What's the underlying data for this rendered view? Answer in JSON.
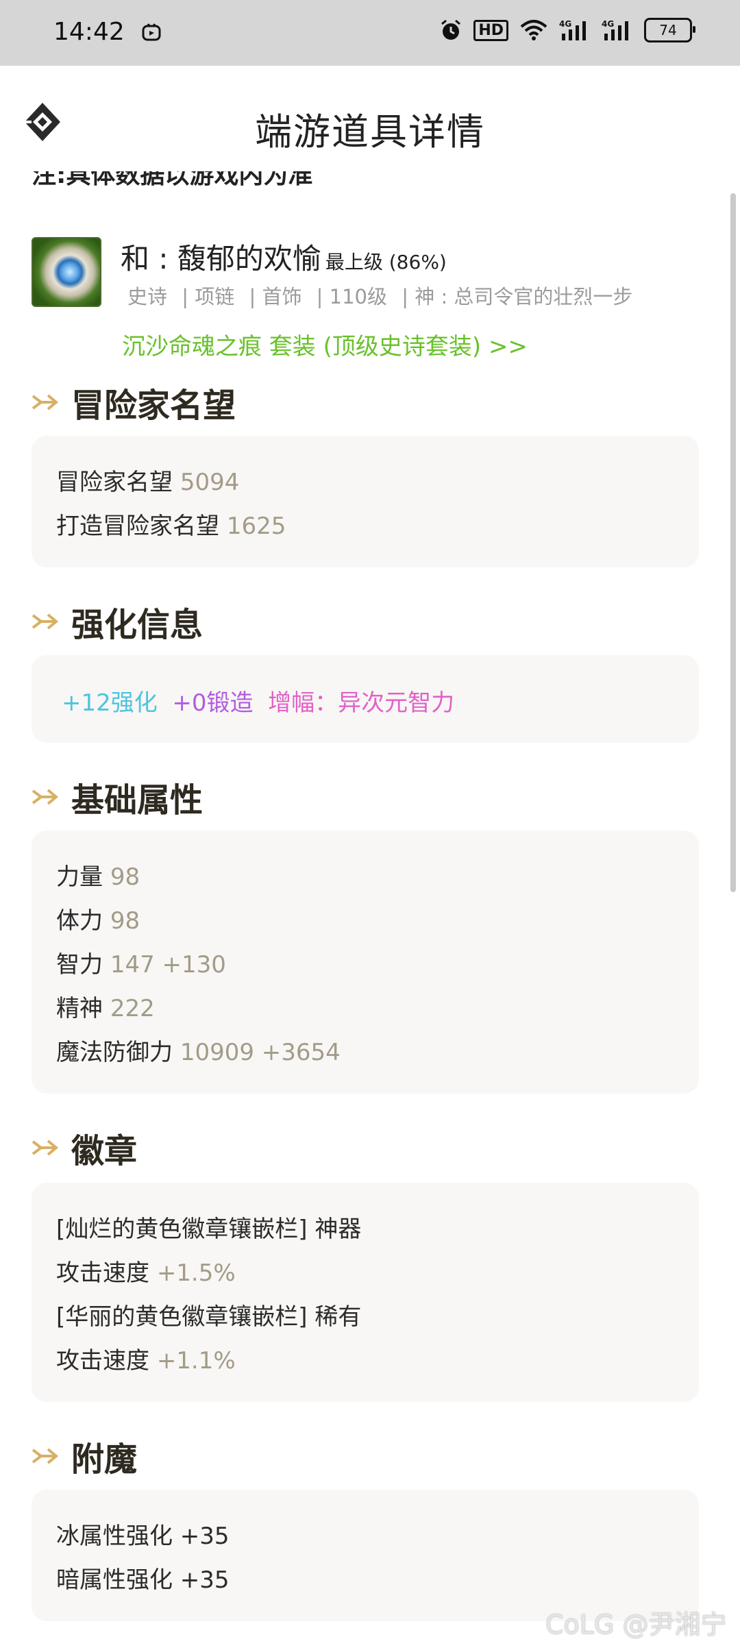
{
  "status_bar": {
    "time": "14:42",
    "battery": "74",
    "icons": [
      "tiktok-icon",
      "alarm-icon",
      "hd-icon",
      "wifi-icon",
      "signal-4g-icon",
      "signal-4g-icon",
      "battery-icon"
    ]
  },
  "header": {
    "title": "端游道具详情"
  },
  "note": "注:具体数据以游戏内为准",
  "item": {
    "name": "和 : 馥郁的欢愉",
    "level_tag": "最上级 (86%)",
    "meta": [
      "史诗",
      "| 项链",
      "| 首饰",
      "| 110级",
      "| 神 : 总司令官的壮烈一步"
    ],
    "set_link": "沉沙命魂之痕 套装 (顶级史诗套装)  >>"
  },
  "sections": {
    "reputation": {
      "title": "冒险家名望",
      "rows": [
        {
          "label": "冒险家名望",
          "value": "5094"
        },
        {
          "label": "打造冒险家名望",
          "value": "1625"
        }
      ]
    },
    "enhance": {
      "title": "强化信息",
      "reinforce": "+12强化",
      "forge": "+0锻造",
      "amplify": "增幅：异次元智力"
    },
    "base_attr": {
      "title": "基础属性",
      "rows": [
        {
          "label": "力量",
          "value": "98"
        },
        {
          "label": "体力",
          "value": "98"
        },
        {
          "label": "智力",
          "value": "147 +130"
        },
        {
          "label": "精神",
          "value": "222"
        },
        {
          "label": "魔法防御力",
          "value": "10909 +3654"
        }
      ]
    },
    "emblem": {
      "title": "徽章",
      "rows": [
        {
          "label": "[灿烂的黄色徽章镶嵌栏] 神器",
          "value": ""
        },
        {
          "label": "攻击速度",
          "value": "+1.5%"
        },
        {
          "label": "[华丽的黄色徽章镶嵌栏] 稀有",
          "value": ""
        },
        {
          "label": "攻击速度",
          "value": "+1.1%"
        }
      ]
    },
    "enchant": {
      "title": "附魔",
      "rows": [
        {
          "label": "冰属性强化 +35"
        },
        {
          "label": "暗属性强化 +35"
        }
      ]
    }
  },
  "watermark": "CoLG @尹湘宁",
  "colors": {
    "accent_arrow": "#d8b064",
    "value_gray": "#a39b88",
    "set_green": "#69c12a"
  }
}
